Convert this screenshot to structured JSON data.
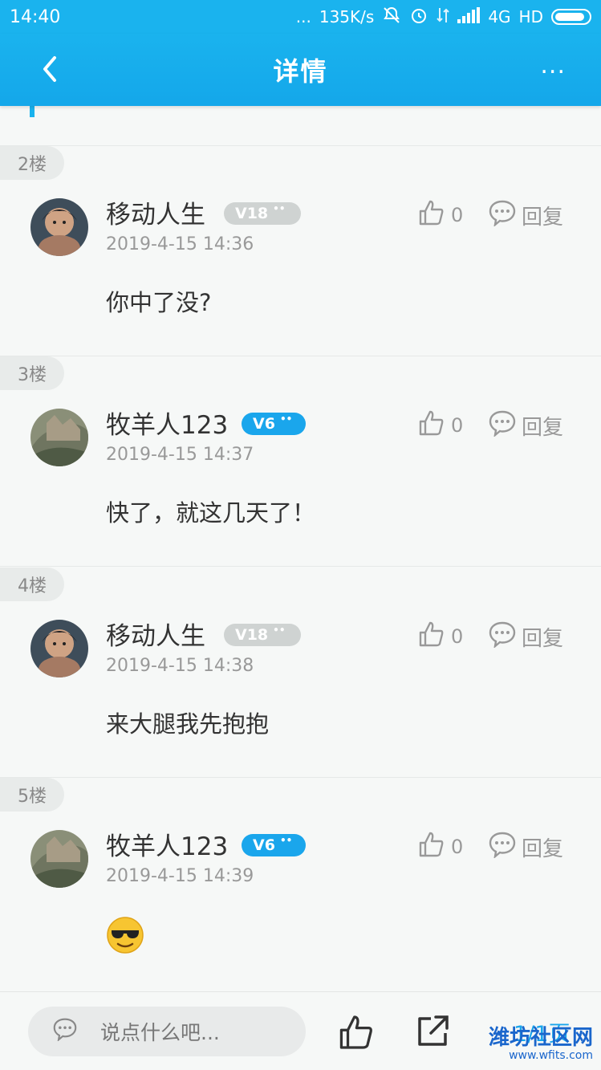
{
  "status_bar": {
    "time": "14:40",
    "dots": "...",
    "speed": "135K/s",
    "network": "4G",
    "hd": "HD"
  },
  "header": {
    "title": "详情",
    "more": "..."
  },
  "posts": [
    {
      "floor": "2楼",
      "username": "移动人生",
      "level": "V18",
      "level_color": "gray",
      "time": "2019-4-15 14:36",
      "likes": "0",
      "reply_label": "回复",
      "content": "你中了没?"
    },
    {
      "floor": "3楼",
      "username": "牧羊人123",
      "level": "V6",
      "level_color": "blue",
      "time": "2019-4-15 14:37",
      "likes": "0",
      "reply_label": "回复",
      "content": "快了，就这几天了！"
    },
    {
      "floor": "4楼",
      "username": "移动人生",
      "level": "V18",
      "level_color": "gray",
      "time": "2019-4-15 14:38",
      "likes": "0",
      "reply_label": "回复",
      "content": "来大腿我先抱抱"
    },
    {
      "floor": "5楼",
      "username": "牧羊人123",
      "level": "V6",
      "level_color": "blue",
      "time": "2019-4-15 14:39",
      "likes": "0",
      "reply_label": "回复",
      "content": ""
    }
  ],
  "bottom": {
    "comment_placeholder": "说点什么吧...",
    "pager": "1/1页"
  },
  "watermark": {
    "name": "潍坊社区网",
    "url": "www.wfits.com"
  },
  "colors": {
    "accent": "#1ab3ee",
    "badge_blue": "#1aa6ec",
    "badge_gray": "#cfd3d2"
  }
}
